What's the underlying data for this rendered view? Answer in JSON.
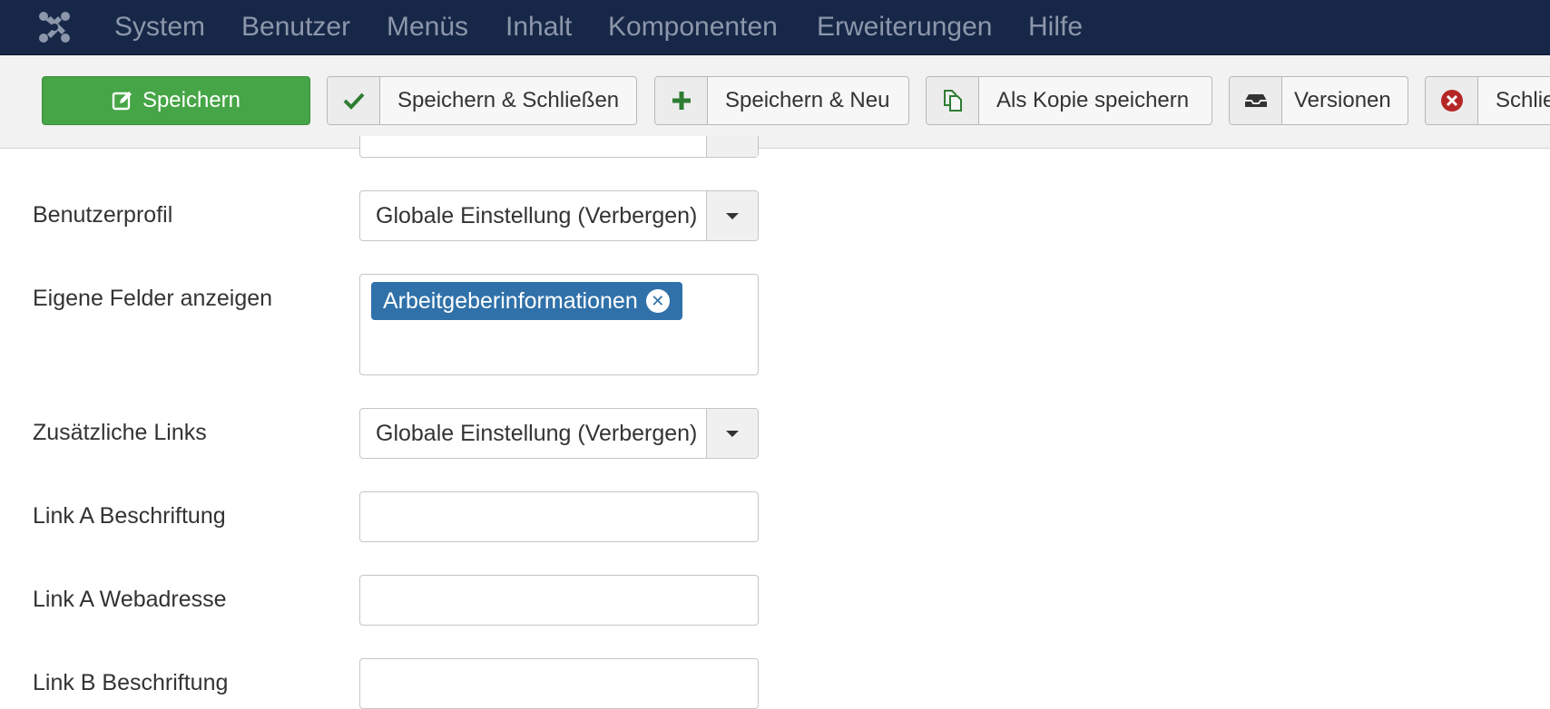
{
  "nav": {
    "logo_icon": "joomla-logo-icon",
    "items": [
      "System",
      "Benutzer",
      "Menüs",
      "Inhalt",
      "Komponenten",
      "Erweiterungen",
      "Hilfe"
    ]
  },
  "toolbar": {
    "save": "Speichern",
    "save_close": "Speichern & Schließen",
    "save_new": "Speichern & Neu",
    "save_copy": "Als Kopie speichern",
    "versions": "Versionen",
    "close": "Schlie"
  },
  "form": {
    "benutzerprofil": {
      "label": "Benutzerprofil",
      "value": "Globale Einstellung (Verbergen)"
    },
    "eigene_felder": {
      "label": "Eigene Felder anzeigen",
      "tags": [
        "Arbeitgeberinformationen"
      ]
    },
    "zusaetzliche_links": {
      "label": "Zusätzliche Links",
      "value": "Globale Einstellung (Verbergen)"
    },
    "link_a_beschriftung": {
      "label": "Link A Beschriftung",
      "value": ""
    },
    "link_a_webadresse": {
      "label": "Link A Webadresse",
      "value": ""
    },
    "link_b_beschriftung": {
      "label": "Link B Beschriftung",
      "value": ""
    }
  },
  "colors": {
    "navbar": "#172747",
    "save_green": "#46a546",
    "tag_blue": "#3071a9",
    "close_red": "#b52727"
  }
}
